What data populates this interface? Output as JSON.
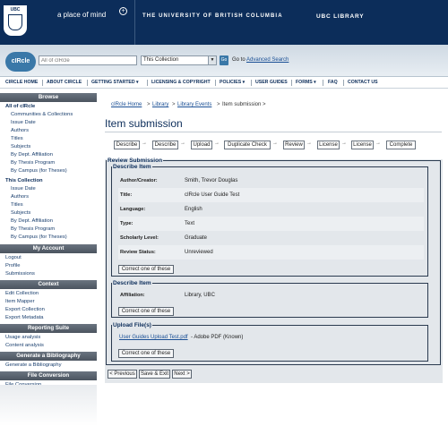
{
  "header": {
    "logo_text": "UBC",
    "tagline": "a place of mind",
    "university": "THE UNIVERSITY OF BRITISH COLUMBIA",
    "library": "UBC LIBRARY"
  },
  "search": {
    "logo_text": "cIRcle",
    "placeholder": "All of cIRcle",
    "scope": "This Collection",
    "go_label": "Go",
    "goto_label": "Go to",
    "advanced_label": "Advanced Search"
  },
  "topnav": [
    "CIRCLE HOME",
    "ABOUT CIRCLE",
    "GETTING STARTED ▾",
    "LICENSING & COPYRIGHT",
    "POLICIES ▾",
    "USER GUIDES",
    "FORMS ▾",
    "FAQ",
    "CONTACT US"
  ],
  "sidebar": {
    "browse_head": "Browse",
    "all_head": "All of cIRcle",
    "all_items": [
      "Communities & Collections",
      "Issue Date",
      "Authors",
      "Titles",
      "Subjects",
      "By Dept. Affiliation",
      "By Thesis Program",
      "By Campus (for Theses)"
    ],
    "coll_head": "This Collection",
    "coll_items": [
      "Issue Date",
      "Authors",
      "Titles",
      "Subjects",
      "By Dept. Affiliation",
      "By Thesis Program",
      "By Campus (for Theses)"
    ],
    "account_head": "My Account",
    "account_items": [
      "Logout",
      "Profile",
      "Submissions"
    ],
    "context_head": "Context",
    "context_items": [
      "Edit Collection",
      "Item Mapper",
      "Export Collection",
      "Export Metadata"
    ],
    "reporting_head": "Reporting Suite",
    "reporting_items": [
      "Usage analysis",
      "Content analysis"
    ],
    "biblio_head": "Generate a Bibliography",
    "biblio_items": [
      "Generate a Bibliography"
    ],
    "conversion_head": "File Conversion",
    "conversion_items": [
      "File Conversion"
    ]
  },
  "breadcrumb": {
    "items": [
      "cIRcle Home",
      "Library",
      "Library Events"
    ],
    "current": "Item submission >"
  },
  "page_title": "Item submission",
  "steps": [
    "Describe",
    "Describe",
    "Upload",
    "Duplicate Check",
    "Review",
    "License",
    "License",
    "Complete"
  ],
  "review": {
    "legend": "Review Submission",
    "describe1": {
      "legend": "Describe Item",
      "rows": [
        {
          "k": "Author/Creator:",
          "v": "Smith, Trevor Douglas"
        },
        {
          "k": "Title:",
          "v": "cIRcle User Guide Test"
        },
        {
          "k": "Language:",
          "v": "English"
        },
        {
          "k": "Type:",
          "v": "Text"
        },
        {
          "k": "Scholarly Level:",
          "v": "Graduate"
        },
        {
          "k": "Review Status:",
          "v": "Unreviewed"
        }
      ],
      "correct_label": "Correct one of these"
    },
    "describe2": {
      "legend": "Describe Item",
      "rows": [
        {
          "k": "Affiliation:",
          "v": "Library, UBC"
        }
      ],
      "correct_label": "Correct one of these"
    },
    "upload": {
      "legend": "Upload File(s)",
      "file_link": "User Guides Upload Test.pdf",
      "file_info": "- Adobe PDF (Known)",
      "correct_label": "Correct one of these"
    }
  },
  "actions": {
    "previous": "< Previous",
    "save_exit": "Save & Exit",
    "next": "Next >"
  },
  "colors": {
    "banner": "#0c2d5a",
    "side_head": "#4b545f",
    "link": "#1a4f95"
  }
}
